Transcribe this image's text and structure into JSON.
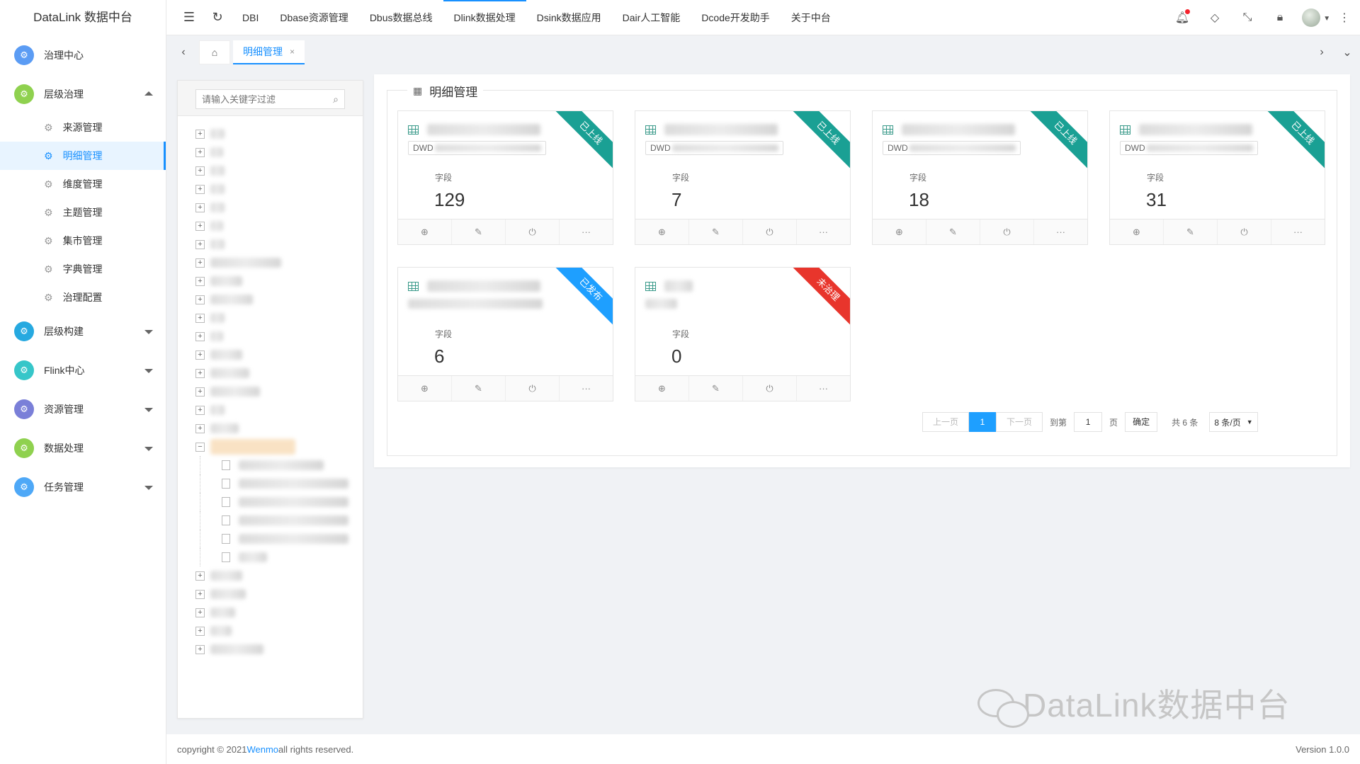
{
  "app": {
    "title": "DataLink 数据中台"
  },
  "sidebar": {
    "groups": [
      {
        "label": "治理中心",
        "color": "#5b9cf4",
        "expanded": false,
        "has_arrow": false
      },
      {
        "label": "层级治理",
        "color": "#8fd14f",
        "expanded": true,
        "has_arrow": true
      },
      {
        "label": "层级构建",
        "color": "#26a9e0",
        "expanded": false,
        "has_arrow": true
      },
      {
        "label": "Flink中心",
        "color": "#36c6c9",
        "expanded": false,
        "has_arrow": true
      },
      {
        "label": "资源管理",
        "color": "#7a7fd8",
        "expanded": false,
        "has_arrow": true
      },
      {
        "label": "数据处理",
        "color": "#8fd14f",
        "expanded": false,
        "has_arrow": true
      },
      {
        "label": "任务管理",
        "color": "#4ea8f7",
        "expanded": false,
        "has_arrow": true
      }
    ],
    "sub_items": [
      "来源管理",
      "明细管理",
      "维度管理",
      "主题管理",
      "集市管理",
      "字典管理",
      "治理配置"
    ],
    "active_sub": "明细管理"
  },
  "topnav": {
    "links": [
      "DBI",
      "Dbase资源管理",
      "Dbus数据总线",
      "Dlink数据处理",
      "Dsink数据应用",
      "Dair人工智能",
      "Dcode开发助手",
      "关于中台"
    ],
    "active": "Dlink数据处理"
  },
  "tabs": {
    "active_label": "明细管理",
    "close": "×"
  },
  "tree": {
    "search_placeholder": "请输入关键字过滤"
  },
  "panel": {
    "title": "明细管理"
  },
  "cards": [
    {
      "prefix": "DWD",
      "field_label": "字段",
      "count": "129",
      "status": "已上线",
      "status_color": "#1aa094"
    },
    {
      "prefix": "DWD",
      "field_label": "字段",
      "count": "7",
      "status": "已上线",
      "status_color": "#1aa094"
    },
    {
      "prefix": "DWD",
      "field_label": "字段",
      "count": "18",
      "status": "已上线",
      "status_color": "#1aa094"
    },
    {
      "prefix": "DWD",
      "field_label": "字段",
      "count": "31",
      "status": "已上线",
      "status_color": "#1aa094"
    },
    {
      "prefix": "",
      "field_label": "字段",
      "count": "6",
      "status": "已发布",
      "status_color": "#1e9fff"
    },
    {
      "prefix": "",
      "field_label": "字段",
      "count": "0",
      "status": "未治理",
      "status_color": "#e8352c"
    }
  ],
  "pager": {
    "prev": "上一页",
    "current": "1",
    "next": "下一页",
    "goto_label": "到第",
    "goto_value": "1",
    "page_unit": "页",
    "confirm": "确定",
    "total": "共 6 条",
    "page_size": "8 条/页"
  },
  "footer": {
    "copyright_pre": "copyright © 2021 ",
    "company": "Wenmo",
    "copyright_post": " all rights reserved.",
    "version": "Version 1.0.0"
  },
  "watermark": {
    "text": "DataLink数据中台"
  }
}
